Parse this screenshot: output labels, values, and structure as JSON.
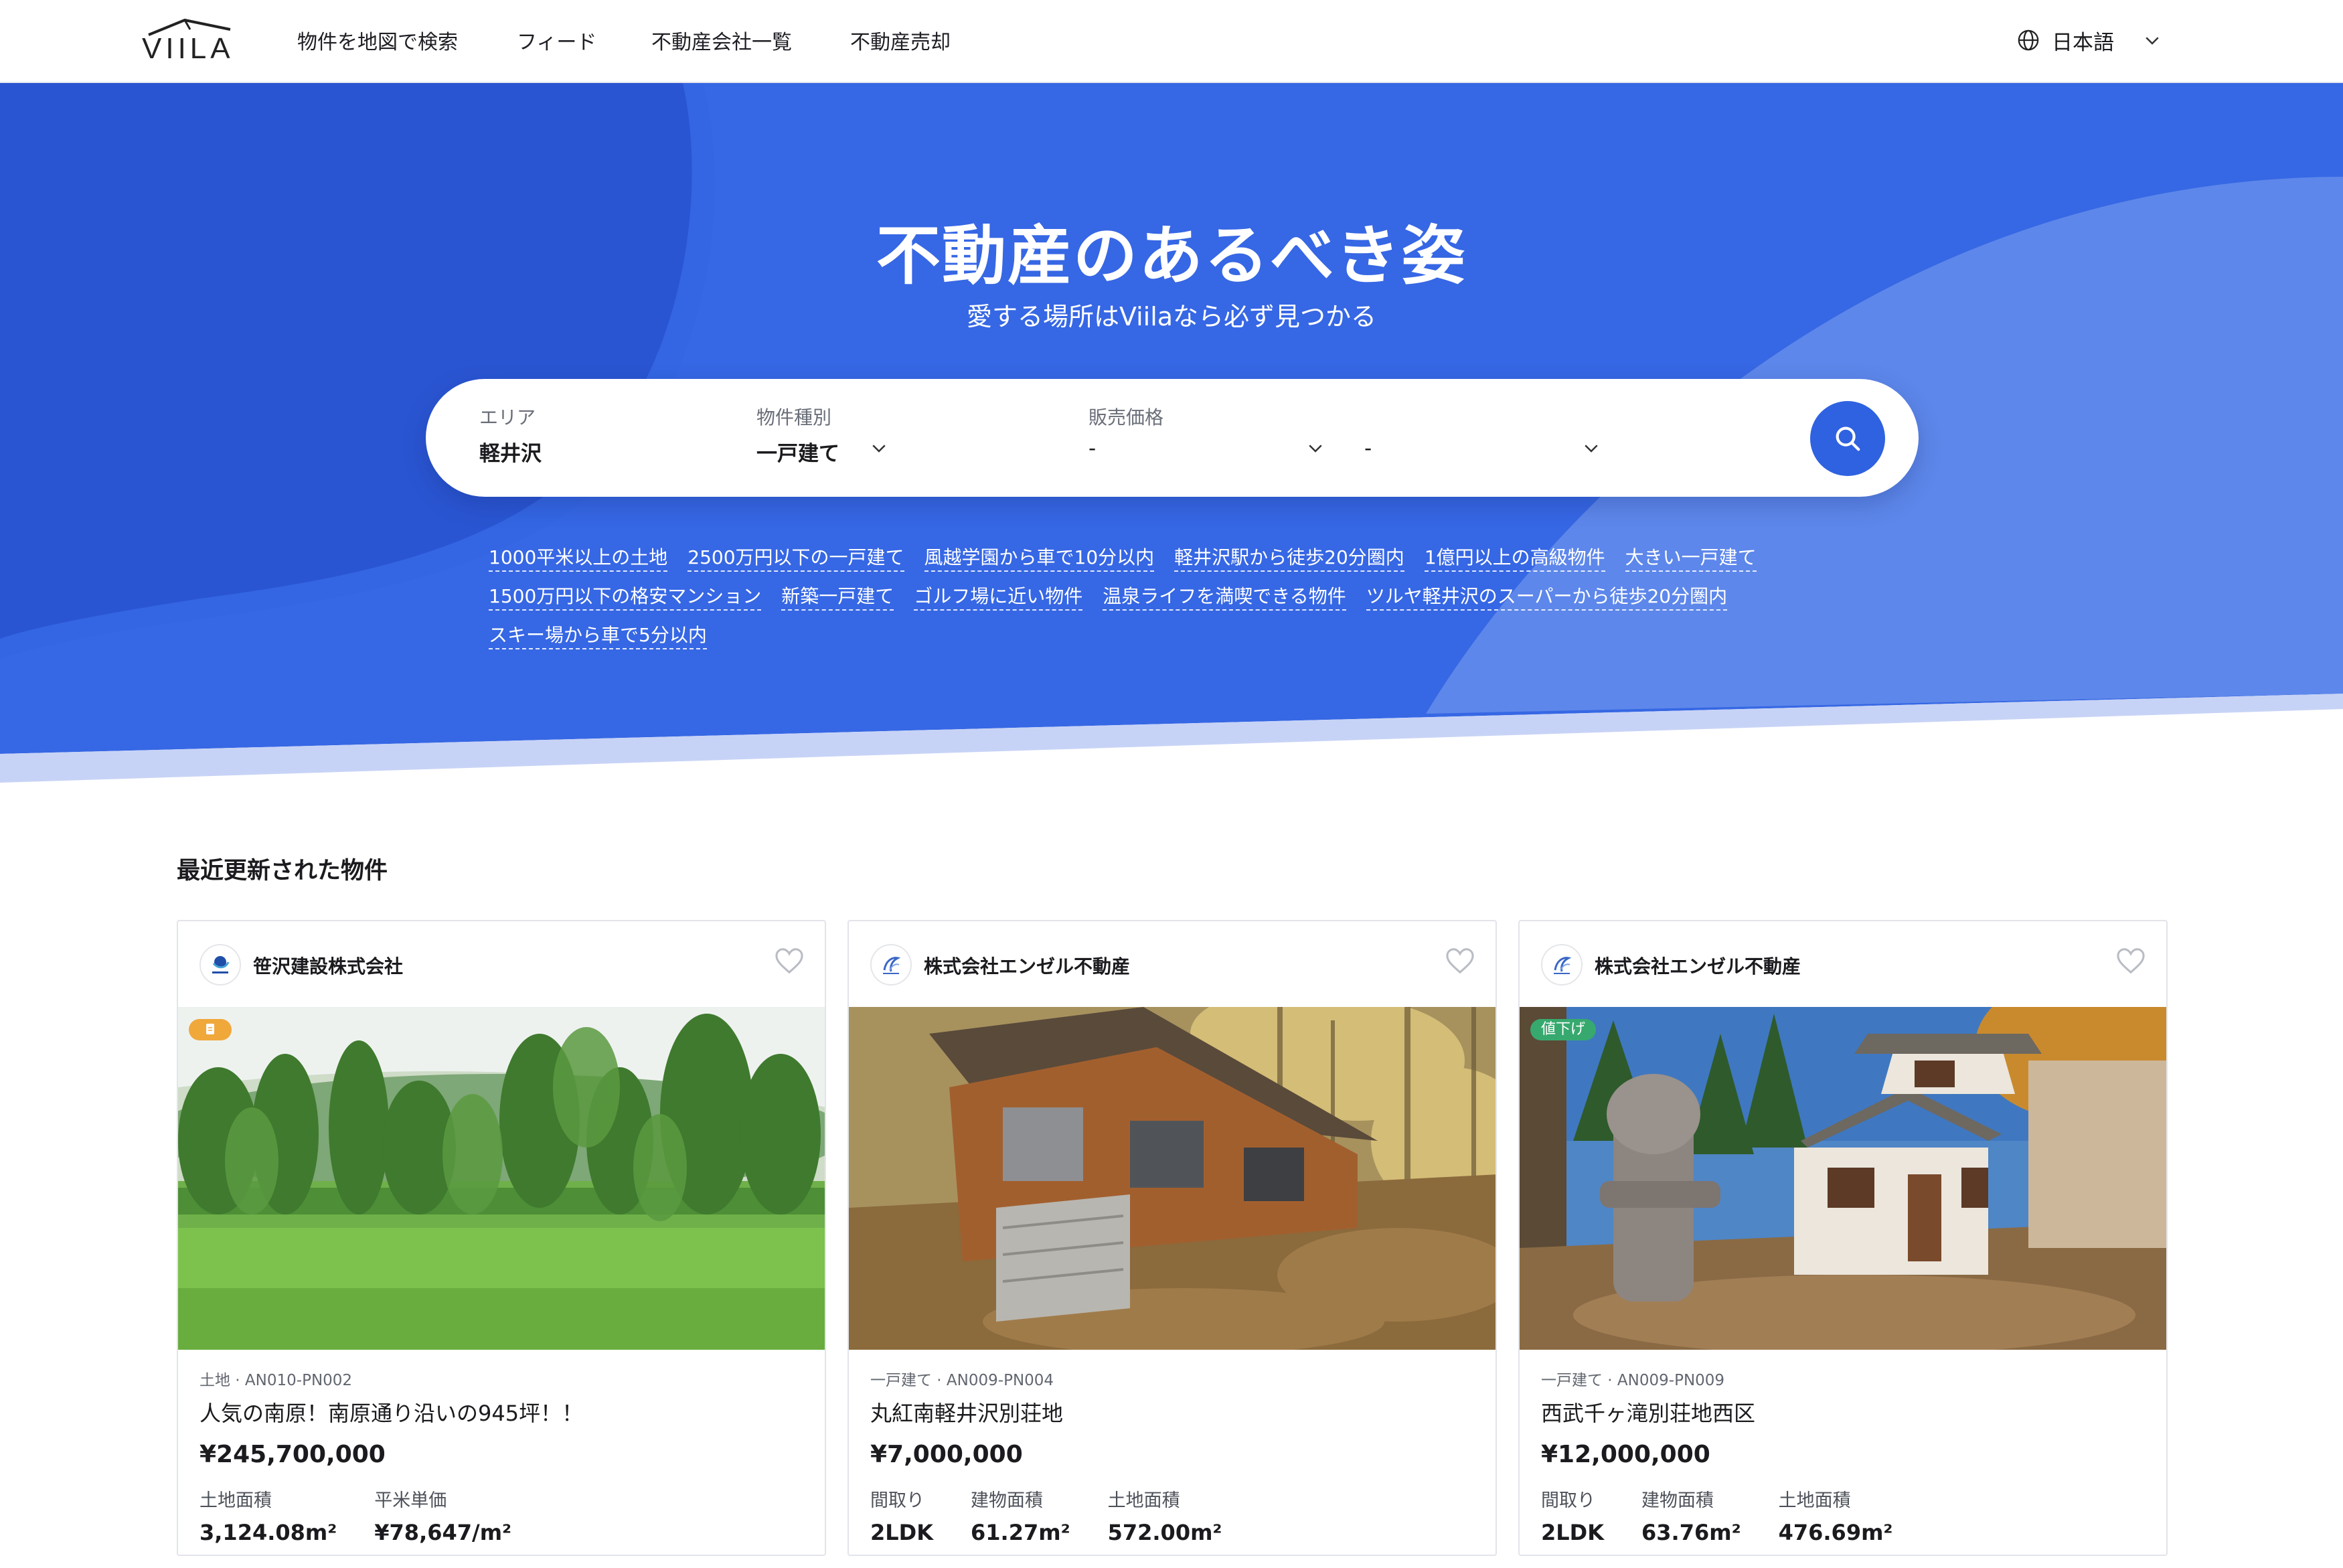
{
  "header": {
    "logo_text": "VIILA",
    "nav": [
      "物件を地図で検索",
      "フィード",
      "不動産会社一覧",
      "不動産売却"
    ],
    "language": "日本語"
  },
  "hero": {
    "title": "不動産のあるべき姿",
    "subtitle": "愛する場所はViilaなら必ず見つかる",
    "search": {
      "area_label": "エリア",
      "area_value": "軽井沢",
      "type_label": "物件種別",
      "type_value": "一戸建て",
      "price_label": "販売価格",
      "price_min": "-",
      "price_max": "-"
    },
    "tags": [
      "1000平米以上の土地",
      "2500万円以下の一戸建て",
      "風越学園から車で10分以内",
      "軽井沢駅から徒歩20分圏内",
      "1億円以上の高級物件",
      "大きい一戸建て",
      "1500万円以下の格安マンション",
      "新築一戸建て",
      "ゴルフ場に近い物件",
      "温泉ライフを満喫できる物件",
      "ツルヤ軽井沢のスーパーから徒歩20分圏内",
      "スキー場から車で5分以内"
    ]
  },
  "listings": {
    "section_title": "最近更新された物件",
    "cards": [
      {
        "company": "笹沢建設株式会社",
        "badge": "",
        "type": "土地 · AN010-PN002",
        "title": "人気の南原！南原通り沿いの945坪！！",
        "price": "¥245,700,000",
        "specs": [
          {
            "label": "土地面積",
            "value": "3,124.08m²"
          },
          {
            "label": "平米単価",
            "value": "¥78,647/m²"
          }
        ]
      },
      {
        "company": "株式会社エンゼル不動産",
        "badge": "",
        "type": "一戸建て · AN009-PN004",
        "title": "丸紅南軽井沢別荘地",
        "price": "¥7,000,000",
        "specs": [
          {
            "label": "間取り",
            "value": "2LDK"
          },
          {
            "label": "建物面積",
            "value": "61.27m²"
          },
          {
            "label": "土地面積",
            "value": "572.00m²"
          }
        ]
      },
      {
        "company": "株式会社エンゼル不動産",
        "badge": "値下げ",
        "type": "一戸建て · AN009-PN009",
        "title": "西武千ヶ滝別荘地西区",
        "price": "¥12,000,000",
        "specs": [
          {
            "label": "間取り",
            "value": "2LDK"
          },
          {
            "label": "建物面積",
            "value": "63.76m²"
          },
          {
            "label": "土地面積",
            "value": "476.69m²"
          }
        ]
      }
    ]
  },
  "colors": {
    "hero_blue": "#3667e4",
    "hero_dark": "#2a55d2",
    "hero_light": "#5d87ea",
    "accent": "#2f62e0"
  },
  "icons": [
    "globe-icon",
    "chevron-down-icon",
    "search-icon",
    "heart-icon",
    "document-icon",
    "house-roof-icon"
  ]
}
